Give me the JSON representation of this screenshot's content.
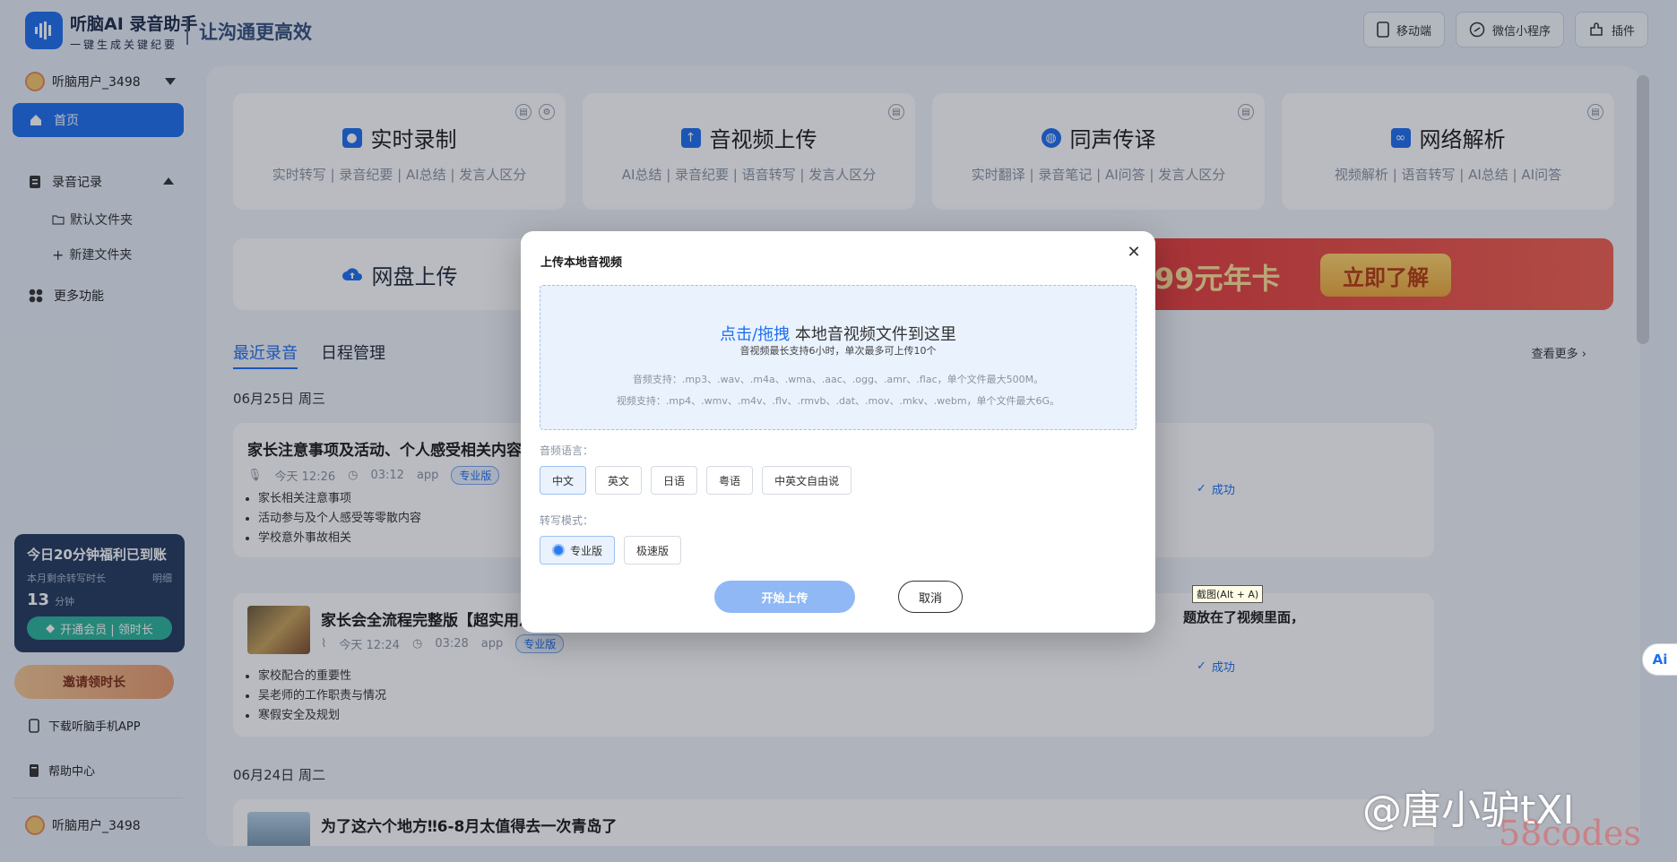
{
  "header": {
    "brand_name": "听脑AI 录音助手",
    "brand_tagline": "一键生成关键纪要",
    "slogan": "让沟通更高效",
    "actions": [
      "移动端",
      "微信小程序",
      "插件"
    ]
  },
  "sidebar": {
    "username": "听脑用户_3498",
    "nav": {
      "home": "首页",
      "records": "录音记录",
      "default_folder": "默认文件夹",
      "new_folder": "新建文件夹",
      "more": "更多功能"
    },
    "promo": {
      "title": "今日20分钟福利已到账",
      "remaining_label": "本月剩余转写时长",
      "detail_link": "明细",
      "minutes": "13",
      "minutes_unit": "分钟",
      "vip_button": "开通会员 | 领时长"
    },
    "invite": "邀请领时长",
    "download_app": "下载听脑手机APP",
    "help_center": "帮助中心",
    "bottom_username": "听脑用户_3498"
  },
  "cards": [
    {
      "title": "实时录制",
      "subtitle": "实时转写 | 录音纪要 | AI总结 | 发言人区分"
    },
    {
      "title": "音视频上传",
      "subtitle": "AI总结 | 录音纪要 | 语音转写 | 发言人区分"
    },
    {
      "title": "同声传译",
      "subtitle": "实时翻译 | 录音笔记 | AI问答 | 发言人区分"
    },
    {
      "title": "网络解析",
      "subtitle": "视频解析 | 语音转写 | AI总结 | AI问答"
    }
  ],
  "cloud_upload": "网盘上传",
  "banner": {
    "text": "99元年卡",
    "button": "立即了解"
  },
  "tabs": {
    "recent": "最近录音",
    "schedule": "日程管理",
    "see_more": "查看更多 ›"
  },
  "groups": [
    {
      "date": "06月25日 周三",
      "records": [
        {
          "title": "家长注意事项及活动、个人感受相关内容",
          "time": "今天 12:26",
          "duration": "03:12",
          "source": "app",
          "edition": "专业版",
          "bullets": [
            "家长相关注意事项",
            "活动参与及个人感受等零散内容",
            "学校意外事故相关"
          ],
          "status": "成功"
        },
        {
          "title": "家长会全流程完整版【超实用思",
          "title_tail": "题放在了视频里面，",
          "time": "今天 12:24",
          "duration": "03:28",
          "source": "app",
          "edition": "专业版",
          "bullets": [
            "家校配合的重要性",
            "吴老师的工作职责与情况",
            "寒假安全及规划"
          ],
          "status": "成功"
        }
      ]
    },
    {
      "date": "06月24日 周二",
      "records": [
        {
          "title": "为了这六个地方‼6-8月太值得去一次青岛了"
        }
      ]
    }
  ],
  "modal": {
    "title": "上传本地音视频",
    "drop_link": "点击/拖拽",
    "drop_text": " 本地音视频文件到这里",
    "drop_hint": "音视频最长支持6小时，单次最多可上传10个",
    "audio_formats": "音频支持：.mp3、.wav、.m4a、.wma、.aac、.ogg、.amr、.flac，单个文件最大500M。",
    "video_formats": "视频支持：.mp4、.wmv、.m4v、.flv、.rmvb、.dat、.mov、.mkv、.webm，单个文件最大6G。",
    "language_label": "音频语言：",
    "languages": [
      "中文",
      "英文",
      "日语",
      "粤语",
      "中英文自由说"
    ],
    "selected_language": "中文",
    "mode_label": "转写模式：",
    "modes": [
      "专业版",
      "极速版"
    ],
    "selected_mode": "专业版",
    "start_button": "开始上传",
    "cancel_button": "取消"
  },
  "tooltip": "截图(Alt + A)",
  "ai_float": "Ai",
  "watermark": "@唐小驴tXI",
  "watermark2": "58codes",
  "colors": {
    "accent": "#1f6ff0",
    "promo_bg": "#233a5e",
    "banner": "#e53b3b"
  }
}
